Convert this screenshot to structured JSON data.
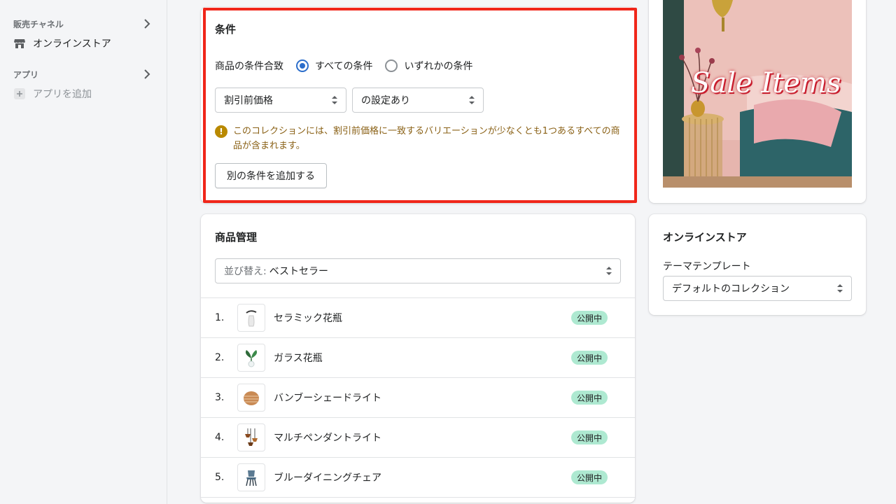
{
  "sidebar": {
    "sales_channels": {
      "heading": "販売チャネル",
      "items": [
        {
          "label": "オンラインストア",
          "icon": "store-icon"
        }
      ]
    },
    "apps": {
      "heading": "アプリ",
      "add_label": "アプリを追加"
    }
  },
  "conditions": {
    "title": "条件",
    "match_label": "商品の条件合致",
    "match_options": [
      {
        "label": "すべての条件",
        "selected": true
      },
      {
        "label": "いずれかの条件",
        "selected": false
      }
    ],
    "field_select": "割引前価格",
    "operator_select": "の設定あり",
    "notice": "このコレクションには、割引前価格に一致するバリエーションが少なくとも1つあるすべての商品が含まれます。",
    "add_condition_button": "別の条件を追加する"
  },
  "product_management": {
    "title": "商品管理",
    "sort_prefix": "並び替え:",
    "sort_value": "ベストセラー",
    "products": [
      {
        "index": "1.",
        "name": "セラミック花瓶",
        "status": "公開中"
      },
      {
        "index": "2.",
        "name": "ガラス花瓶",
        "status": "公開中"
      },
      {
        "index": "3.",
        "name": "バンブーシェードライト",
        "status": "公開中"
      },
      {
        "index": "4.",
        "name": "マルチペンダントライト",
        "status": "公開中"
      },
      {
        "index": "5.",
        "name": "ブルーダイニングチェア",
        "status": "公開中"
      }
    ]
  },
  "collection_image": {
    "text": "Sale Items"
  },
  "online_store": {
    "title": "オンラインストア",
    "theme_template_label": "テーマテンプレート",
    "theme_template_value": "デフォルトのコレクション"
  },
  "colors": {
    "highlight": "#f0261a",
    "accent": "#2c6ecb",
    "badge_bg": "#aee9d1",
    "warning_text": "#8a6116"
  }
}
